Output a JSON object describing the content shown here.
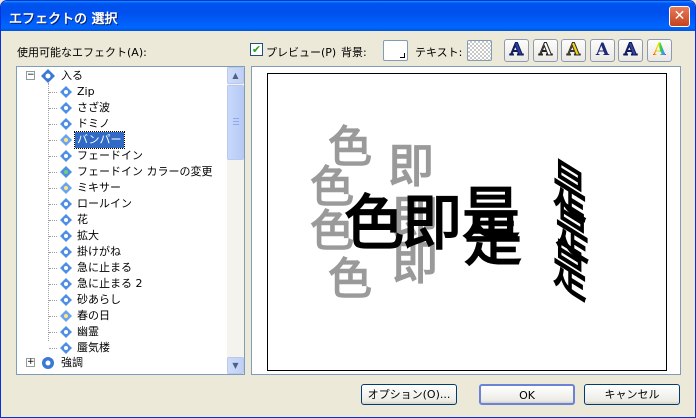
{
  "dialog": {
    "title": "エフェクトの 選択"
  },
  "labels": {
    "effects_list": "使用可能なエフェクト(A):",
    "preview": "プレビュー(P)",
    "background": "背景:",
    "text": "テキスト:"
  },
  "preview_checked": true,
  "style_buttons": [
    {
      "name": "style-blue-outline",
      "glyph": "A",
      "color": "#2b3f9e"
    },
    {
      "name": "style-outline",
      "glyph": "A",
      "color": "#ffffff"
    },
    {
      "name": "style-yellow",
      "glyph": "A",
      "color": "#f2d40c"
    },
    {
      "name": "style-navy-bold",
      "glyph": "A",
      "color": "#1b2a7a"
    },
    {
      "name": "style-blue-white",
      "glyph": "A",
      "color": "#34449c"
    },
    {
      "name": "style-rainbow",
      "glyph": "A",
      "color": "#d93b8e"
    }
  ],
  "tree": {
    "groups": [
      {
        "label": "入る",
        "expanded": true
      },
      {
        "label": "強調",
        "expanded": false
      }
    ],
    "items": [
      {
        "label": "Zip",
        "icon": "diamond-arrows-icon"
      },
      {
        "label": "さざ波",
        "icon": "diamond-icon"
      },
      {
        "label": "ドミノ",
        "icon": "diamond-icon"
      },
      {
        "label": "バンパー",
        "icon": "diamond-spark-icon",
        "selected": true
      },
      {
        "label": "フェードイン",
        "icon": "diamond-icon"
      },
      {
        "label": "フェードイン カラーの変更",
        "icon": "diamond-color-icon"
      },
      {
        "label": "ミキサー",
        "icon": "diamond-spark-icon"
      },
      {
        "label": "ロールイン",
        "icon": "diamond-icon"
      },
      {
        "label": "花",
        "icon": "diamond-icon"
      },
      {
        "label": "拡大",
        "icon": "diamond-icon"
      },
      {
        "label": "掛けがね",
        "icon": "diamond-icon"
      },
      {
        "label": "急に止まる",
        "icon": "diamond-icon"
      },
      {
        "label": "急に止まる 2",
        "icon": "diamond-icon"
      },
      {
        "label": "砂あらし",
        "icon": "diamond-icon"
      },
      {
        "label": "春の日",
        "icon": "diamond-spark-icon"
      },
      {
        "label": "幽霊",
        "icon": "diamond-icon"
      },
      {
        "label": "蜃気楼",
        "icon": "diamond-icon"
      }
    ]
  },
  "preview_glyphs": {
    "ghost": "色",
    "main": [
      "色",
      "即",
      "是"
    ]
  },
  "buttons": {
    "options": "オプション(O)...",
    "ok": "OK",
    "cancel": "キャンセル"
  }
}
